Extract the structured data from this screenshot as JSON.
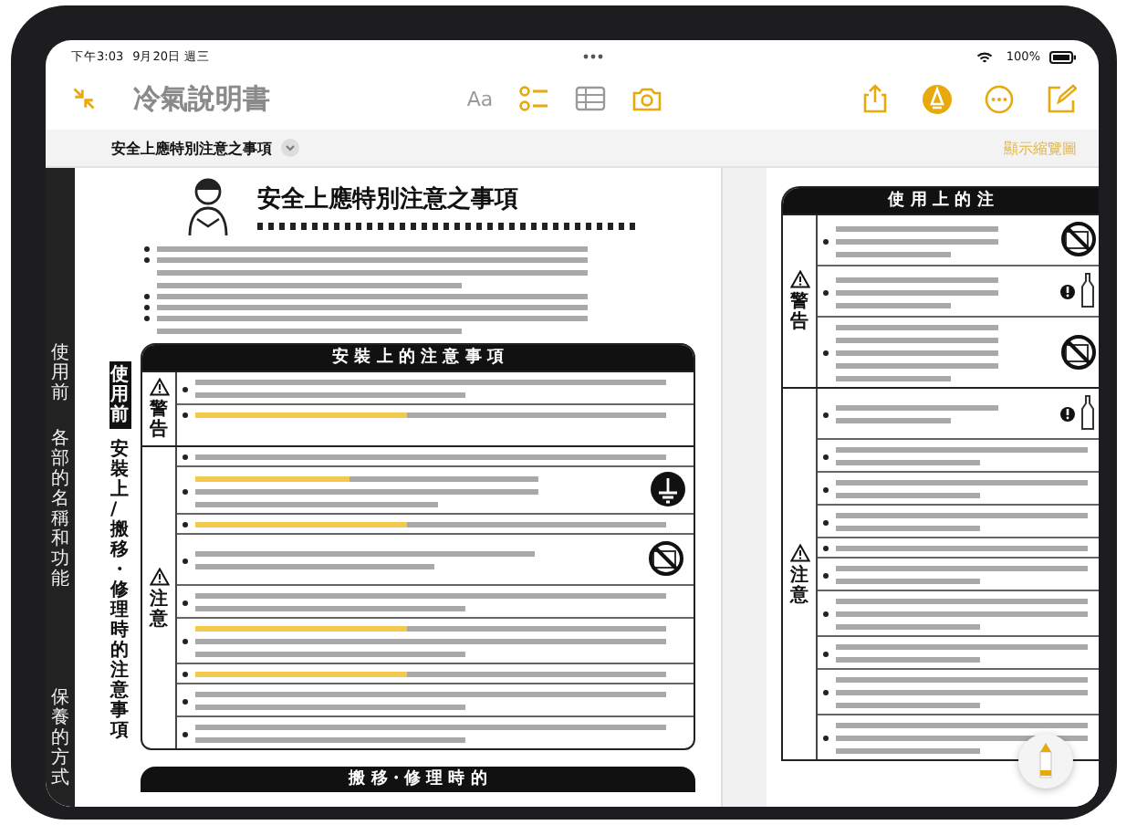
{
  "status_bar": {
    "time": "下午3:03",
    "date": "9月20日 週三",
    "battery": "100%"
  },
  "note": {
    "title": "冷氣說明書"
  },
  "toolbar": {
    "center": [
      {
        "kind": "format",
        "label": "Aa",
        "disabled": true
      },
      {
        "kind": "checklist",
        "disabled": false
      },
      {
        "kind": "table",
        "disabled": true
      },
      {
        "kind": "camera",
        "disabled": false
      }
    ],
    "right": [
      {
        "kind": "share",
        "on": false
      },
      {
        "kind": "markup",
        "on": true
      },
      {
        "kind": "more",
        "on": false
      },
      {
        "kind": "compose",
        "on": false
      }
    ]
  },
  "attachment": {
    "title": "安全上應特別注意之事項",
    "action": "顯示縮覽圖"
  },
  "side_index": [
    {
      "label": "使用前"
    },
    {
      "label": "各部的名稱和功能"
    },
    {
      "label": "保養的方式"
    }
  ],
  "left_page": {
    "tabs": [
      {
        "label": "使用前",
        "selected": true
      },
      {
        "label": "安裝上/搬移・修理時的注意事項",
        "selected": false
      }
    ],
    "heading": "安全上應特別注意之事項",
    "bullets": [
      {
        "lines": [
          {
            "highlighted": false
          }
        ]
      },
      {
        "lines": [
          {
            "highlighted": false
          },
          {
            "highlighted": false
          },
          {
            "highlighted": false
          }
        ]
      },
      {
        "lines": [
          {
            "highlighted": false
          }
        ]
      },
      {
        "lines": [
          {
            "highlighted": false
          }
        ]
      },
      {
        "lines": [
          {
            "highlighted": false
          },
          {
            "highlighted": false
          }
        ]
      }
    ],
    "table": {
      "title": "安 裝 上 的 注 意 事 項",
      "groups": [
        {
          "label": "警告",
          "rows": [
            {
              "kind": "text",
              "lines": [
                {
                  "highlighted": false
                },
                {
                  "highlighted": false
                }
              ]
            },
            {
              "kind": "text",
              "lines": [
                {
                  "highlighted": true
                }
              ]
            }
          ]
        },
        {
          "label": "注意",
          "rows": [
            {
              "kind": "text",
              "lines": [
                {
                  "highlighted": false
                }
              ]
            },
            {
              "kind": "ground",
              "lines": [
                {
                  "highlighted": true
                },
                {
                  "highlighted": false
                },
                {
                  "highlighted": false
                }
              ]
            },
            {
              "kind": "text",
              "lines": [
                {
                  "highlighted": true
                }
              ]
            },
            {
              "kind": "prohibit",
              "lines": [
                {
                  "highlighted": false
                },
                {
                  "highlighted": false
                }
              ]
            },
            {
              "kind": "text",
              "lines": [
                {
                  "highlighted": false
                },
                {
                  "highlighted": false
                }
              ]
            },
            {
              "kind": "text",
              "lines": [
                {
                  "highlighted": true
                },
                {
                  "highlighted": false
                },
                {
                  "highlighted": false
                }
              ]
            },
            {
              "kind": "text",
              "lines": [
                {
                  "highlighted": true
                }
              ]
            },
            {
              "kind": "text",
              "lines": [
                {
                  "highlighted": false
                },
                {
                  "highlighted": false
                }
              ]
            },
            {
              "kind": "text",
              "lines": [
                {
                  "highlighted": false
                },
                {
                  "highlighted": false
                }
              ]
            }
          ]
        }
      ]
    },
    "next_title": "搬 移・修 理 時 的"
  },
  "right_page": {
    "table": {
      "title": "使 用 上 的 注",
      "groups": [
        {
          "label": "警告",
          "rows": [
            {
              "kind": "prohibit",
              "lines": [
                {
                  "highlighted": false
                },
                {
                  "highlighted": false
                },
                {
                  "highlighted": false
                }
              ]
            },
            {
              "kind": "plug",
              "lines": [
                {
                  "highlighted": false
                },
                {
                  "highlighted": false
                },
                {
                  "highlighted": false
                }
              ]
            },
            {
              "kind": "prohibit",
              "lines": [
                {
                  "highlighted": false
                },
                {
                  "highlighted": false
                },
                {
                  "highlighted": false
                },
                {
                  "highlighted": false
                },
                {
                  "highlighted": false
                }
              ]
            }
          ]
        },
        {
          "label": "注意",
          "rows": [
            {
              "kind": "plug",
              "lines": [
                {
                  "highlighted": false
                },
                {
                  "highlighted": false
                }
              ]
            },
            {
              "kind": "text",
              "lines": [
                {
                  "highlighted": false
                },
                {
                  "highlighted": false
                }
              ]
            },
            {
              "kind": "text",
              "lines": [
                {
                  "highlighted": false
                },
                {
                  "highlighted": false
                }
              ]
            },
            {
              "kind": "text",
              "lines": [
                {
                  "highlighted": false
                },
                {
                  "highlighted": false
                }
              ]
            },
            {
              "kind": "text",
              "lines": [
                {
                  "highlighted": false
                }
              ]
            },
            {
              "kind": "text",
              "lines": [
                {
                  "highlighted": false
                },
                {
                  "highlighted": false
                }
              ]
            },
            {
              "kind": "text",
              "lines": [
                {
                  "highlighted": false
                },
                {
                  "highlighted": false
                },
                {
                  "highlighted": false
                }
              ]
            },
            {
              "kind": "text",
              "lines": [
                {
                  "highlighted": false
                },
                {
                  "highlighted": false
                }
              ]
            },
            {
              "kind": "text",
              "lines": [
                {
                  "highlighted": false
                },
                {
                  "highlighted": false
                },
                {
                  "highlighted": false
                }
              ]
            },
            {
              "kind": "text",
              "lines": [
                {
                  "highlighted": false
                },
                {
                  "highlighted": false
                },
                {
                  "highlighted": false
                }
              ]
            }
          ]
        }
      ]
    }
  }
}
